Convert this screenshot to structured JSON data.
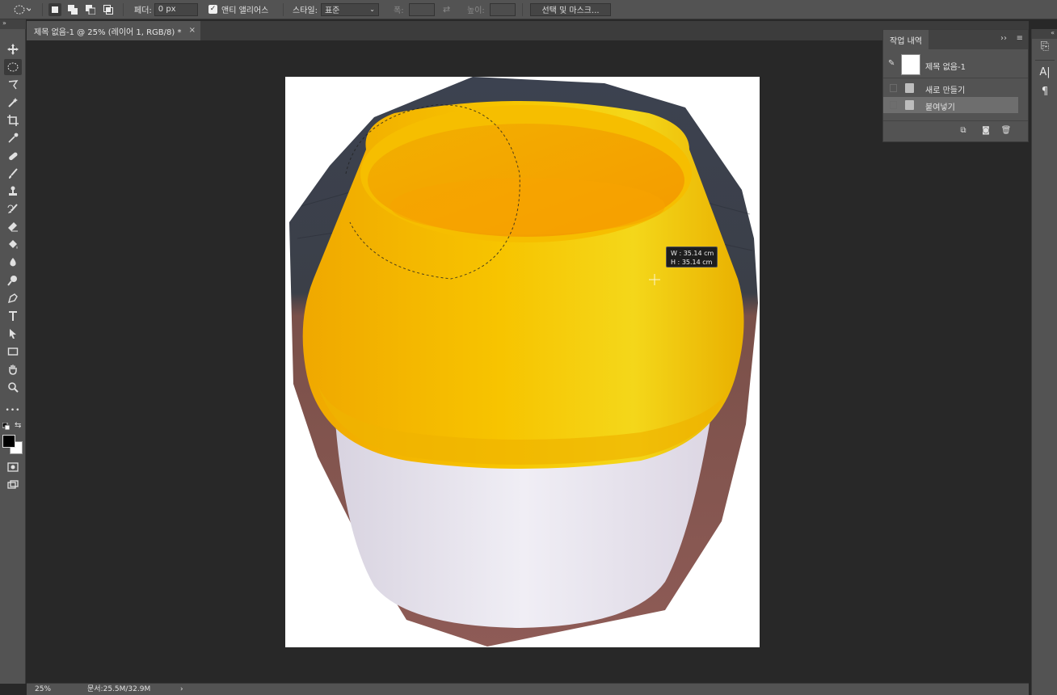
{
  "options_bar": {
    "feather_label": "페더:",
    "feather_value": "0 px",
    "antialias_label": "앤티 앨리어스",
    "style_label": "스타일:",
    "style_value": "표준",
    "width_label": "폭:",
    "height_label": "높이:",
    "select_mask_label": "선택 및 마스크..."
  },
  "document_tab": {
    "title": "제목 없음-1 @ 25% (레이어 1, RGB/8) *",
    "close": "×"
  },
  "toolbar": {
    "tools": [
      {
        "name": "move-tool",
        "icon": "move-icon"
      },
      {
        "name": "elliptical-marquee-tool",
        "icon": "ellipse-marquee-icon",
        "active": true
      },
      {
        "name": "lasso-tool",
        "icon": "lasso-icon"
      },
      {
        "name": "magic-wand-tool",
        "icon": "magic-wand-icon"
      },
      {
        "name": "crop-tool",
        "icon": "crop-icon"
      },
      {
        "name": "eyedropper-tool",
        "icon": "eyedropper-icon"
      },
      {
        "name": "healing-brush-tool",
        "icon": "bandage-icon"
      },
      {
        "name": "brush-tool",
        "icon": "brush-icon"
      },
      {
        "name": "clone-stamp-tool",
        "icon": "stamp-icon"
      },
      {
        "name": "history-brush-tool",
        "icon": "history-brush-icon"
      },
      {
        "name": "eraser-tool",
        "icon": "eraser-icon"
      },
      {
        "name": "paint-bucket-tool",
        "icon": "bucket-icon"
      },
      {
        "name": "blur-tool",
        "icon": "blur-icon"
      },
      {
        "name": "dodge-tool",
        "icon": "dodge-icon"
      },
      {
        "name": "pen-tool",
        "icon": "pen-icon"
      },
      {
        "name": "type-tool",
        "icon": "type-icon"
      },
      {
        "name": "path-selection-tool",
        "icon": "arrow-icon"
      },
      {
        "name": "rectangle-tool",
        "icon": "rectangle-icon"
      },
      {
        "name": "hand-tool",
        "icon": "hand-icon"
      },
      {
        "name": "zoom-tool",
        "icon": "zoom-icon"
      }
    ],
    "more": "•••",
    "foreground_color": "#000000",
    "background_color": "#ffffff"
  },
  "measure_tooltip": {
    "w_label": "W :",
    "w_value": "35.14 cm",
    "h_label": "H :",
    "h_value": "35.14 cm"
  },
  "history_panel": {
    "title": "작업 내역",
    "collapse": "››",
    "menu": "≡",
    "snapshot_label": "제목 없음-1",
    "items": [
      {
        "label": "새로 만들기",
        "selected": false
      },
      {
        "label": "붙여넣기",
        "selected": true
      }
    ]
  },
  "status_bar": {
    "zoom": "25%",
    "doc_info": "문서:25.5M/32.9M",
    "arrow": "›"
  },
  "colors": {
    "panel_bg": "#535353",
    "dark_bg": "#282828",
    "vase_yellow": "#f5b800",
    "vase_white": "#e6e4ee",
    "table_brown": "#8a5a55"
  }
}
